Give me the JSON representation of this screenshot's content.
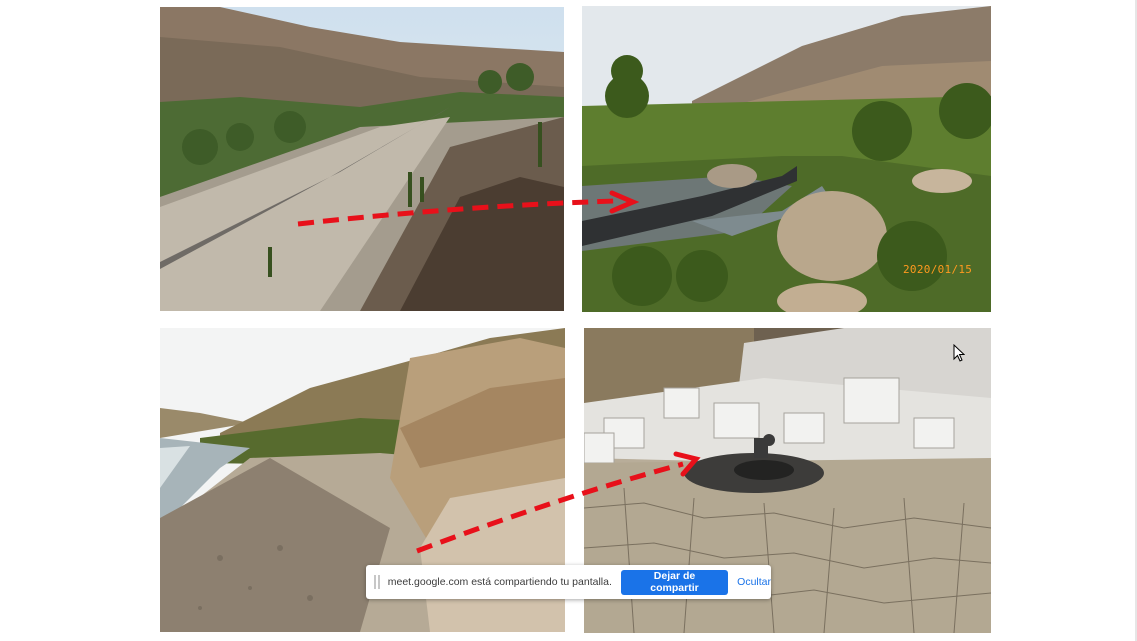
{
  "photos": [
    {
      "id": "valley-pipeline",
      "stamp": ""
    },
    {
      "id": "river-liner",
      "stamp": "2020/01/15"
    },
    {
      "id": "river-rocks",
      "stamp": ""
    },
    {
      "id": "dry-riverbed",
      "stamp": ""
    }
  ],
  "share_bar": {
    "message": "meet.google.com está compartiendo tu pantalla.",
    "stop_label": "Dejar de compartir",
    "hide_label": "Ocultar"
  },
  "colors": {
    "arrow": "#e8101a",
    "accent": "#1a73e8",
    "stamp": "#ff9a1f"
  },
  "icons": [
    "drag-handle-icon",
    "mouse-cursor-icon"
  ]
}
